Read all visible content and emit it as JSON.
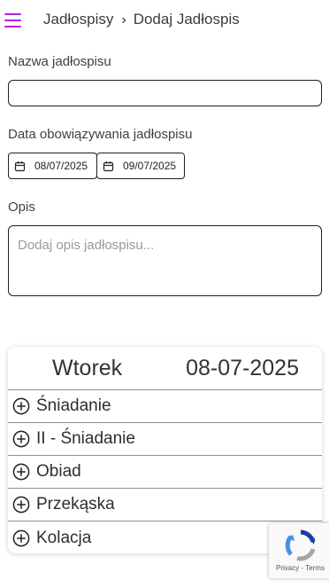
{
  "header": {
    "breadcrumb_root": "Jadłospisy",
    "breadcrumb_sep": "›",
    "breadcrumb_current": "Dodaj Jadłospis",
    "menu_color": "#b620e0"
  },
  "form": {
    "name_label": "Nazwa jadłospisu",
    "name_value": "",
    "date_label": "Data obowiązywania jadłospisu",
    "date_from": "08/07/2025",
    "date_to": "09/07/2025",
    "desc_label": "Opis",
    "desc_placeholder": "Dodaj opis jadłospisu..."
  },
  "day_card": {
    "day": "Wtorek",
    "date": "08-07-2025",
    "meals": [
      {
        "label": "Śniadanie"
      },
      {
        "label": "II - Śniadanie"
      },
      {
        "label": "Obiad"
      },
      {
        "label": "Przekąska"
      },
      {
        "label": "Kolacja"
      }
    ]
  },
  "recaptcha": {
    "links": "Privacy - Terms"
  }
}
